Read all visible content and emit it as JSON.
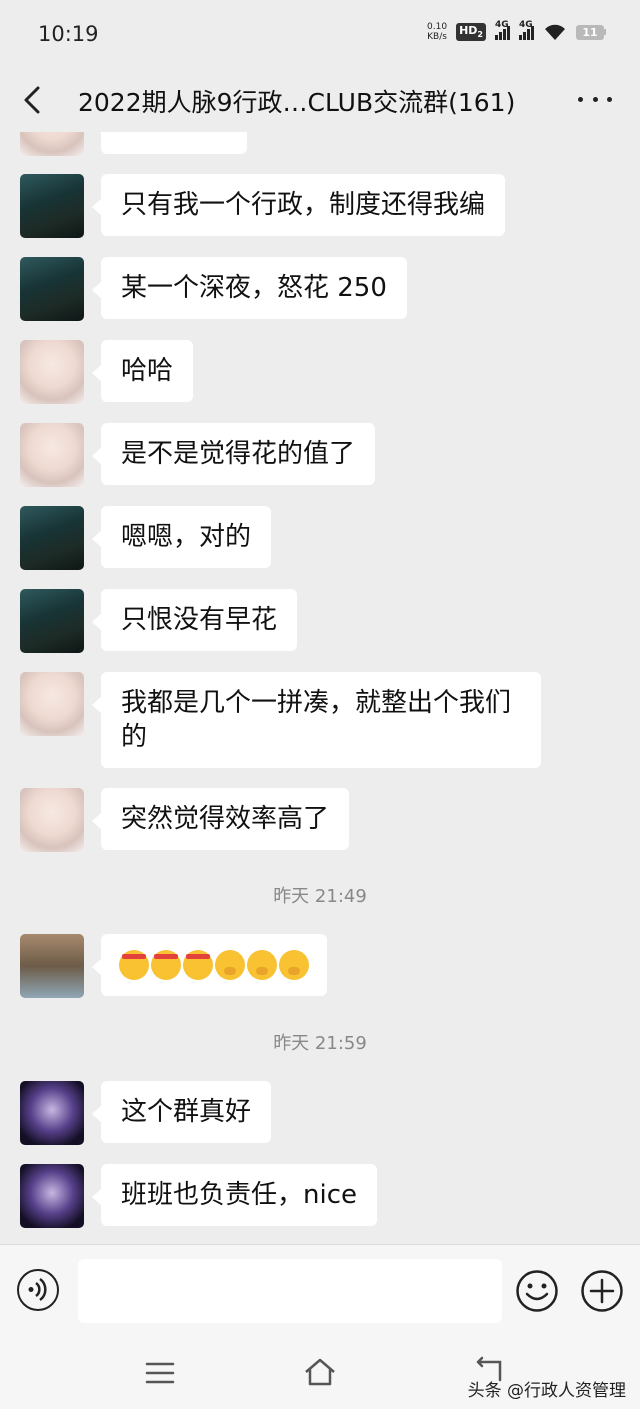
{
  "status_bar": {
    "time": "10:19",
    "net_speed_value": "0.10",
    "net_speed_unit": "KB/s",
    "hd_label": "HD",
    "hd_sub": "2",
    "sim1_label": "4G",
    "sim2_label": "4G",
    "battery": "11"
  },
  "header": {
    "title": "2022期人脉9行政…CLUB交流群(161)"
  },
  "messages": [
    {
      "type": "text",
      "avatar": "dark-landscape",
      "text": "只有我一个行政，制度还得我编"
    },
    {
      "type": "text",
      "avatar": "dark-landscape",
      "text": "某一个深夜，怒花 250"
    },
    {
      "type": "text",
      "avatar": "fox-mask-girl",
      "text": "哈哈"
    },
    {
      "type": "text",
      "avatar": "fox-mask-girl",
      "text": "是不是觉得花的值了"
    },
    {
      "type": "text",
      "avatar": "dark-landscape",
      "text": "嗯嗯，对的"
    },
    {
      "type": "text",
      "avatar": "dark-landscape",
      "text": "只恨没有早花"
    },
    {
      "type": "text",
      "avatar": "fox-mask-girl",
      "text": "我都是几个一拼凑，就整出个我们的"
    },
    {
      "type": "text",
      "avatar": "fox-mask-girl",
      "text": "突然觉得效率高了"
    },
    {
      "type": "time",
      "text": "昨天 21:49"
    },
    {
      "type": "emoji",
      "avatar": "photo",
      "emojis": [
        "face-with-headband",
        "face-with-headband",
        "face-with-headband",
        "face-hand-over-mouth",
        "face-hand-over-mouth",
        "face-hand-over-mouth"
      ]
    },
    {
      "type": "time",
      "text": "昨天 21:59"
    },
    {
      "type": "text",
      "avatar": "anime-girl",
      "text": "这个群真好"
    },
    {
      "type": "text",
      "avatar": "anime-girl",
      "text": "班班也负责任，nice"
    }
  ],
  "input_bar": {
    "placeholder": ""
  },
  "watermark": "头条 @行政人资管理",
  "colors": {
    "background": "#ededed",
    "bubble": "#ffffff",
    "timestamp": "#888888"
  }
}
